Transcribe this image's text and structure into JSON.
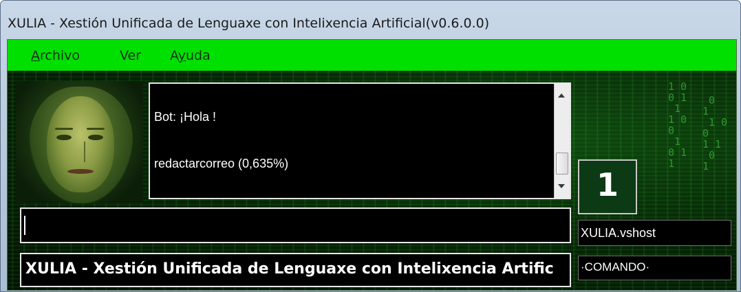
{
  "window": {
    "title": "XULIA - Xestión Unificada de Lenguaxe con Intelixencia Artificial(v0.6.0.0)"
  },
  "menu": {
    "items": [
      {
        "label": "Archivo",
        "mnemonic": "A",
        "rest": "rchivo"
      },
      {
        "label": "Ver"
      },
      {
        "label": "Ayuda",
        "pre": "A",
        "mnemonic": "y",
        "rest": "uda"
      }
    ]
  },
  "chat": {
    "lines": [
      "Bot: ¡Hola !",
      "redactarcorreo (0,635%)"
    ]
  },
  "input": {
    "value": ""
  },
  "status": {
    "text": "XULIA - Xestión Unificada de Lenguaxe con Intelixencia Artific"
  },
  "counter": {
    "value": "1"
  },
  "host": {
    "label": "XULIA.vshost"
  },
  "command": {
    "label": "·COMANDO·"
  },
  "colors": {
    "menu_bg": "#00e000",
    "background": "#051a05",
    "matrix_green": "#49e049",
    "panel_bg": "#000000",
    "counter_bg": "#0c3a14"
  },
  "icons": {
    "avatar": "matrix-face-avatar"
  }
}
